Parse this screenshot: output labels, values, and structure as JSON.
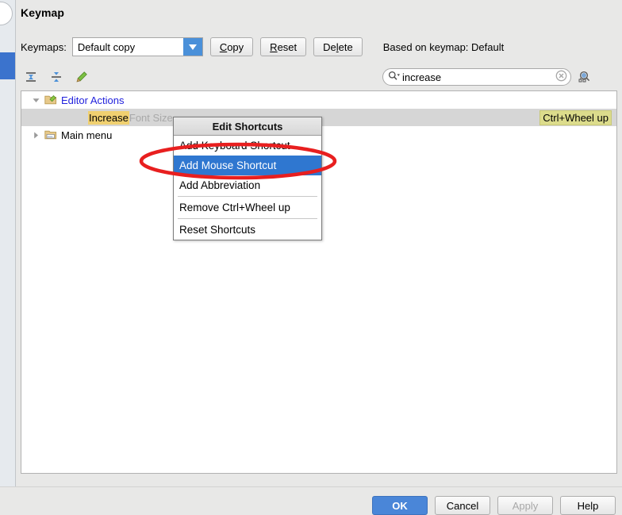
{
  "window": {
    "title": "Keymap"
  },
  "left_rail": {
    "circle_icon": "circle-icon",
    "selected_item": "sidebar-selected-indicator"
  },
  "keymap_row": {
    "label": "Keymaps:",
    "combo_value": "Default copy",
    "combo_arrow_icon": "chevron-down-icon",
    "buttons": [
      {
        "name": "copy-button",
        "pre": "C",
        "post": "opy"
      },
      {
        "name": "reset-button",
        "pre": "R",
        "post": "eset"
      },
      {
        "name": "delete-button",
        "pre": "De",
        "post": "lete",
        "mid": "l"
      }
    ],
    "copy_label": "Copy",
    "reset_label": "Reset",
    "delete_label": "Delete",
    "based_on": "Based on keymap: Default"
  },
  "toolbar": {
    "expand_all_icon": "expand-all-icon",
    "collapse_all_icon": "collapse-all-icon",
    "edit_icon": "pencil-edit-icon"
  },
  "search": {
    "icon": "search-magnifier-icon",
    "value": "increase",
    "placeholder": "",
    "clear_icon": "clear-circle-icon",
    "find_shortcut_icon": "find-by-shortcut-icon"
  },
  "tree": {
    "rows": [
      {
        "name": "tree-row-editor-actions",
        "indent": 0,
        "twisty": "expanded",
        "icon": "folder-edit-icon",
        "label": "Editor Actions",
        "style": "link"
      },
      {
        "name": "tree-row-increase-font-size",
        "indent": 1,
        "twisty": "none",
        "icon": "none",
        "label_match": "Increase",
        "label_rest": " Font Size",
        "selected": true,
        "shortcut": "Ctrl+Wheel up"
      },
      {
        "name": "tree-row-main-menu",
        "indent": 0,
        "twisty": "collapsed",
        "icon": "folder-menu-icon",
        "label": "Main menu",
        "style": "plain"
      }
    ]
  },
  "context_menu": {
    "title": "Edit Shortcuts",
    "items": [
      {
        "name": "menu-item-add-keyboard-shortcut",
        "label": "Add Keyboard Shortcut",
        "highlighted": false
      },
      {
        "name": "menu-item-add-mouse-shortcut",
        "label": "Add Mouse Shortcut",
        "highlighted": true
      },
      {
        "name": "menu-item-add-abbreviation",
        "label": "Add Abbreviation",
        "highlighted": false
      },
      {
        "name": "menu-item-remove-shortcut",
        "label": "Remove Ctrl+Wheel up",
        "highlighted": false
      },
      {
        "name": "menu-item-reset-shortcuts",
        "label": "Reset Shortcuts",
        "highlighted": false
      }
    ]
  },
  "annotation": {
    "shape": "red-ellipse-highlight",
    "color": "#e81f1f",
    "target": "Add Mouse Shortcut"
  },
  "footer": {
    "ok": "OK",
    "cancel": "Cancel",
    "apply": "Apply",
    "help": "Help"
  },
  "colors": {
    "accent_blue": "#3b73cd",
    "menu_highlight": "#2f77d0",
    "match_highlight": "#f0d070",
    "shortcut_badge": "#dcdc8c",
    "annotation_red": "#e81f1f"
  }
}
